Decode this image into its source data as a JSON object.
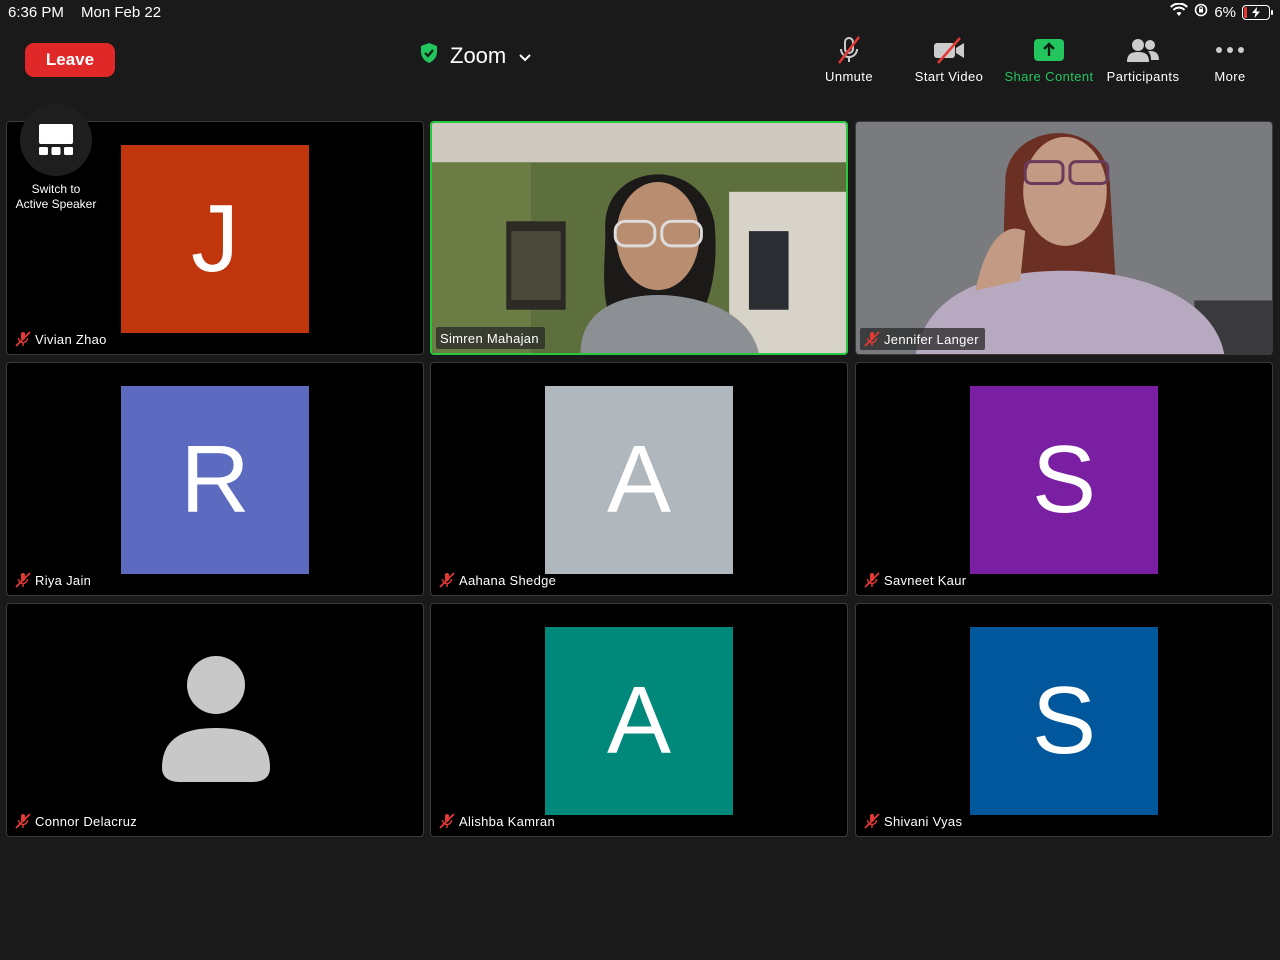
{
  "status_bar": {
    "time": "6:36 PM",
    "date": "Mon Feb 22",
    "battery": "6%"
  },
  "toolbar": {
    "leave_label": "Leave",
    "meeting_title": "Zoom",
    "unmute_label": "Unmute",
    "start_video_label": "Start Video",
    "share_content_label": "Share Content",
    "participants_label": "Participants",
    "more_label": "More"
  },
  "view_switch": {
    "label_line1": "Switch to",
    "label_line2": "Active Speaker"
  },
  "participants": [
    {
      "name": "Vivian Zhao",
      "initial": "J",
      "color": "#bf360c",
      "muted": true
    },
    {
      "name": "Simren Mahajan",
      "initial": "",
      "color": "",
      "muted": false,
      "video": true,
      "active": true
    },
    {
      "name": "Jennifer Langer",
      "initial": "",
      "color": "",
      "muted": true,
      "video": true
    },
    {
      "name": "Riya Jain",
      "initial": "R",
      "color": "#5c6bc0",
      "muted": true
    },
    {
      "name": "Aahana Shedge",
      "initial": "A",
      "color": "#b0b7bd",
      "muted": true
    },
    {
      "name": "Savneet Kaur",
      "initial": "S",
      "color": "#7b1fa2",
      "muted": true
    },
    {
      "name": "Connor Delacruz",
      "initial": "",
      "color": "",
      "muted": true,
      "placeholder": true
    },
    {
      "name": "Alishba Kamran",
      "initial": "A",
      "color": "#00897b",
      "muted": true
    },
    {
      "name": "Shivani Vyas",
      "initial": "S",
      "color": "#01579b",
      "muted": true
    }
  ]
}
